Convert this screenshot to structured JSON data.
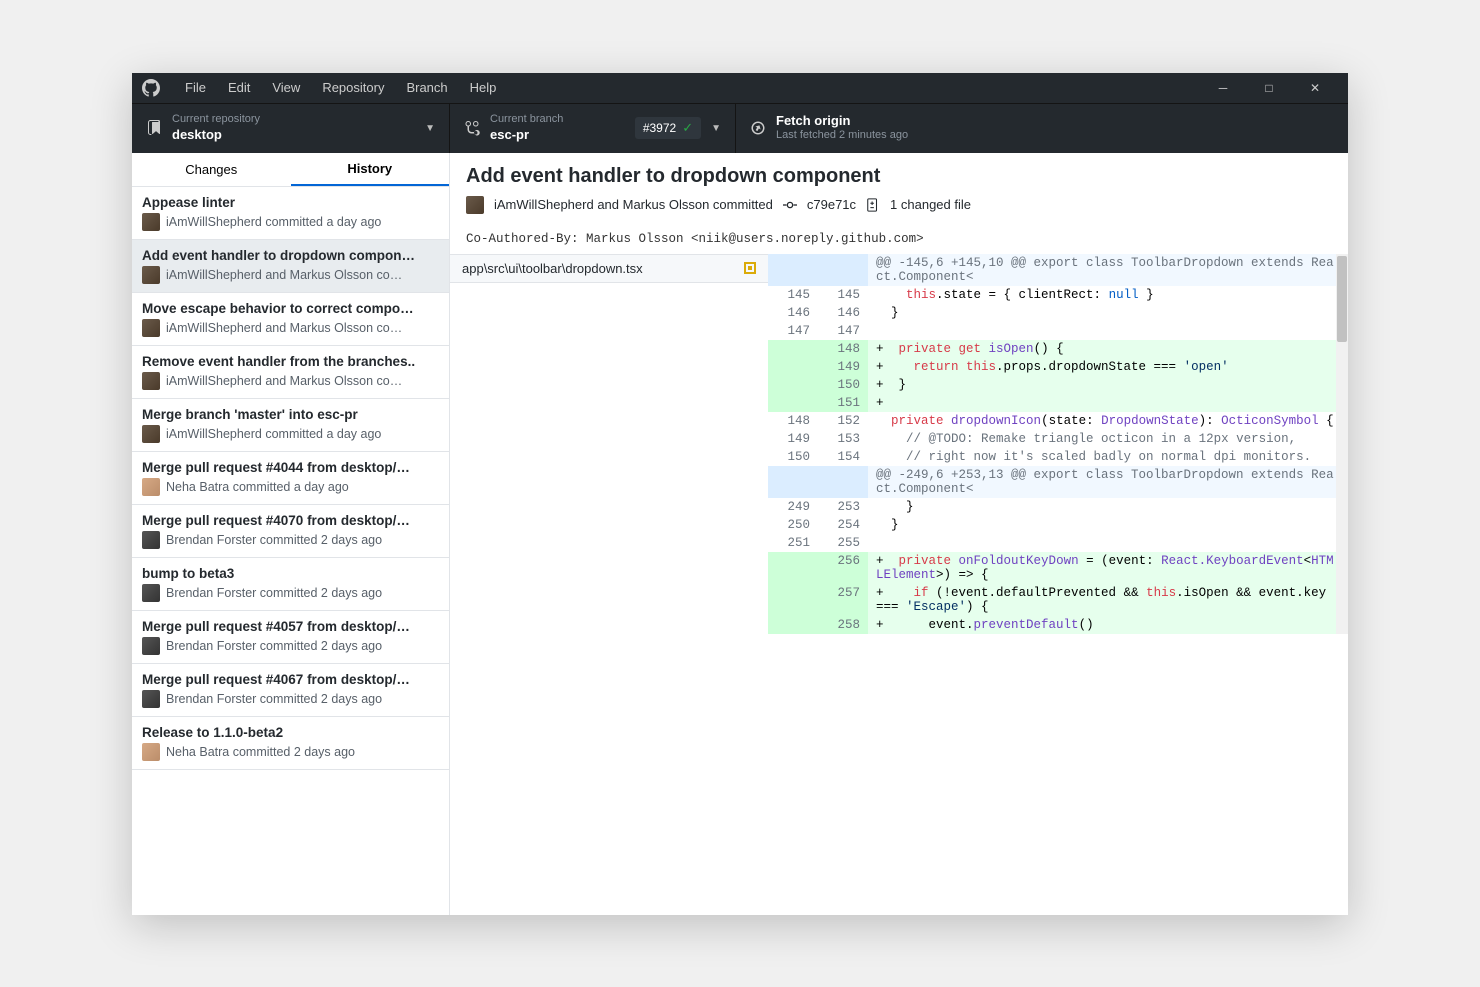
{
  "menus": [
    "File",
    "Edit",
    "View",
    "Repository",
    "Branch",
    "Help"
  ],
  "toolbar": {
    "repo": {
      "label": "Current repository",
      "value": "desktop"
    },
    "branch": {
      "label": "Current branch",
      "value": "esc-pr",
      "pr": "#3972"
    },
    "fetch": {
      "label": "Fetch origin",
      "sub": "Last fetched 2 minutes ago"
    }
  },
  "tabs": {
    "changes": "Changes",
    "history": "History"
  },
  "commits": [
    {
      "title": "Appease linter",
      "meta": "iAmWillShepherd committed a day ago",
      "avatar": "a"
    },
    {
      "title": "Add event handler to dropdown compon…",
      "meta": "iAmWillShepherd and Markus Olsson co…",
      "avatar": "a",
      "selected": true
    },
    {
      "title": "Move escape behavior to correct compo…",
      "meta": "iAmWillShepherd and Markus Olsson co…",
      "avatar": "a"
    },
    {
      "title": "Remove event handler from the branches..",
      "meta": "iAmWillShepherd and Markus Olsson co…",
      "avatar": "a"
    },
    {
      "title": "Merge branch 'master' into esc-pr",
      "meta": "iAmWillShepherd committed a day ago",
      "avatar": "a"
    },
    {
      "title": "Merge pull request #4044 from desktop/…",
      "meta": "Neha Batra committed a day ago",
      "avatar": "c"
    },
    {
      "title": "Merge pull request #4070 from desktop/…",
      "meta": "Brendan Forster committed 2 days ago",
      "avatar": "d"
    },
    {
      "title": "bump to beta3",
      "meta": "Brendan Forster committed 2 days ago",
      "avatar": "d"
    },
    {
      "title": "Merge pull request #4057 from desktop/…",
      "meta": "Brendan Forster committed 2 days ago",
      "avatar": "d"
    },
    {
      "title": "Merge pull request #4067 from desktop/…",
      "meta": "Brendan Forster committed 2 days ago",
      "avatar": "d"
    },
    {
      "title": "Release to 1.1.0-beta2",
      "meta": "Neha Batra committed 2 days ago",
      "avatar": "c"
    }
  ],
  "commit_detail": {
    "title": "Add event handler to dropdown component",
    "authors": "iAmWillShepherd and Markus Olsson committed",
    "sha": "c79e71c",
    "changed_files": "1 changed file",
    "description": "Co-Authored-By: Markus Olsson <niik@users.noreply.github.com>",
    "file_path": "app\\src\\ui\\toolbar\\dropdown.tsx"
  },
  "diff": [
    {
      "type": "hunk",
      "text": "@@ -145,6 +145,10 @@ export class ToolbarDropdown extends React.Component<"
    },
    {
      "type": "ctx",
      "old": "145",
      "new": "145",
      "html": "    <span class='kw-red'>this</span>.state = { clientRect: <span class='kw-blue'>null</span> }"
    },
    {
      "type": "ctx",
      "old": "146",
      "new": "146",
      "html": "  }"
    },
    {
      "type": "ctx",
      "old": "147",
      "new": "147",
      "html": ""
    },
    {
      "type": "add",
      "new": "148",
      "html": "+  <span class='kw-red'>private get</span> <span class='kw-purple'>isOpen</span>() {"
    },
    {
      "type": "add",
      "new": "149",
      "html": "+    <span class='kw-red'>return this</span>.props.dropdownState === <span class='str'>'open'</span>"
    },
    {
      "type": "add",
      "new": "150",
      "html": "+  }"
    },
    {
      "type": "add",
      "new": "151",
      "html": "+"
    },
    {
      "type": "ctx",
      "old": "148",
      "new": "152",
      "html": "  <span class='kw-red'>private</span> <span class='kw-purple'>dropdownIcon</span>(state: <span class='kw-purple'>DropdownState</span>): <span class='kw-purple'>OcticonSymbol</span> {"
    },
    {
      "type": "ctx",
      "old": "149",
      "new": "153",
      "html": "    <span class='comment'>// @TODO: Remake triangle octicon in a 12px version,</span>"
    },
    {
      "type": "ctx",
      "old": "150",
      "new": "154",
      "html": "    <span class='comment'>// right now it's scaled badly on normal dpi monitors.</span>"
    },
    {
      "type": "hunk",
      "text": "@@ -249,6 +253,13 @@ export class ToolbarDropdown extends React.Component<"
    },
    {
      "type": "ctx",
      "old": "249",
      "new": "253",
      "html": "    }"
    },
    {
      "type": "ctx",
      "old": "250",
      "new": "254",
      "html": "  }"
    },
    {
      "type": "ctx",
      "old": "251",
      "new": "255",
      "html": ""
    },
    {
      "type": "add",
      "new": "256",
      "html": "+  <span class='kw-red'>private</span> <span class='kw-purple'>onFoldoutKeyDown</span> = (event: <span class='kw-purple'>React.KeyboardEvent</span>&lt;<span class='kw-purple'>HTMLElement</span>&gt;) =&gt; {"
    },
    {
      "type": "add",
      "new": "257",
      "html": "+    <span class='kw-red'>if</span> (!event.defaultPrevented &amp;&amp; <span class='kw-red'>this</span>.isOpen &amp;&amp; event.key === <span class='str'>'Escape'</span>) {"
    },
    {
      "type": "add",
      "new": "258",
      "html": "+      event.<span class='kw-purple'>preventDefault</span>()"
    }
  ]
}
